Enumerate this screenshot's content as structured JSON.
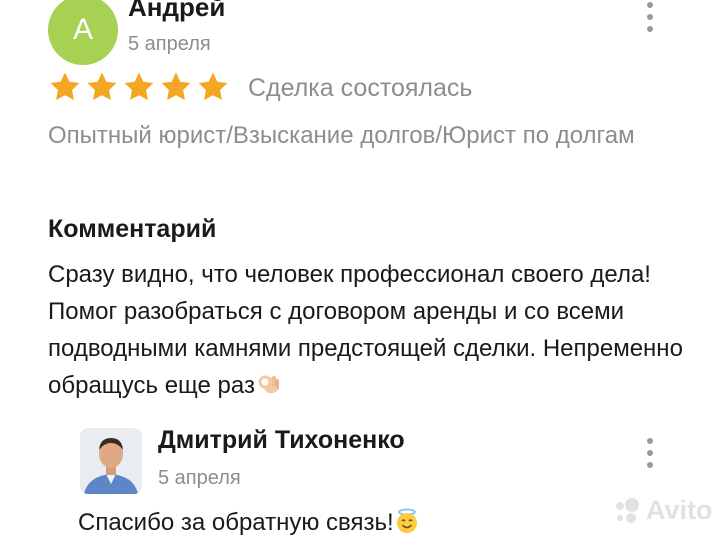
{
  "review": {
    "avatar_letter": "А",
    "author": "Андрей",
    "date": "5 апреля",
    "rating": 5,
    "deal_status": "Сделка состоялась",
    "service": "Опытный юрист/Взыскание долгов/Юрист по долгам",
    "comment_heading": "Комментарий",
    "comment_text": "Сразу видно, что человек профессионал своего дела! Помог разобраться с договором аренды и со всеми подводными камнями предстоящей сделки. Непременно обращусь еще раз"
  },
  "reply": {
    "author": "Дмитрий Тихоненко",
    "date": "5 апреля",
    "text": "Спасибо за обратную связь!"
  },
  "watermark": {
    "text": "Avito"
  },
  "colors": {
    "avatar_bg": "#a6d152",
    "star": "#f5a623",
    "muted_text": "#8d8d8d",
    "main_text": "#1a1a1a"
  },
  "icons": [
    "more-vertical-icon",
    "star-icon",
    "ok-hand-emoji",
    "smiling-angel-emoji",
    "avito-logo"
  ]
}
